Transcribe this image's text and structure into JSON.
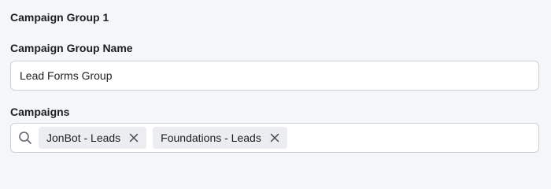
{
  "group": {
    "title": "Campaign Group 1"
  },
  "name_field": {
    "label": "Campaign Group Name",
    "value": "Lead Forms Group"
  },
  "campaigns_field": {
    "label": "Campaigns",
    "icon": "search-icon",
    "tokens": [
      {
        "label": "JonBot - Leads",
        "remove_icon": "close-icon"
      },
      {
        "label": "Foundations - Leads",
        "remove_icon": "close-icon"
      }
    ]
  },
  "colors": {
    "background": "#f5f6f7",
    "input_border": "#ccd0d5",
    "token_background": "#ebedf0",
    "text": "#1c1e21",
    "icon": "#606770"
  }
}
